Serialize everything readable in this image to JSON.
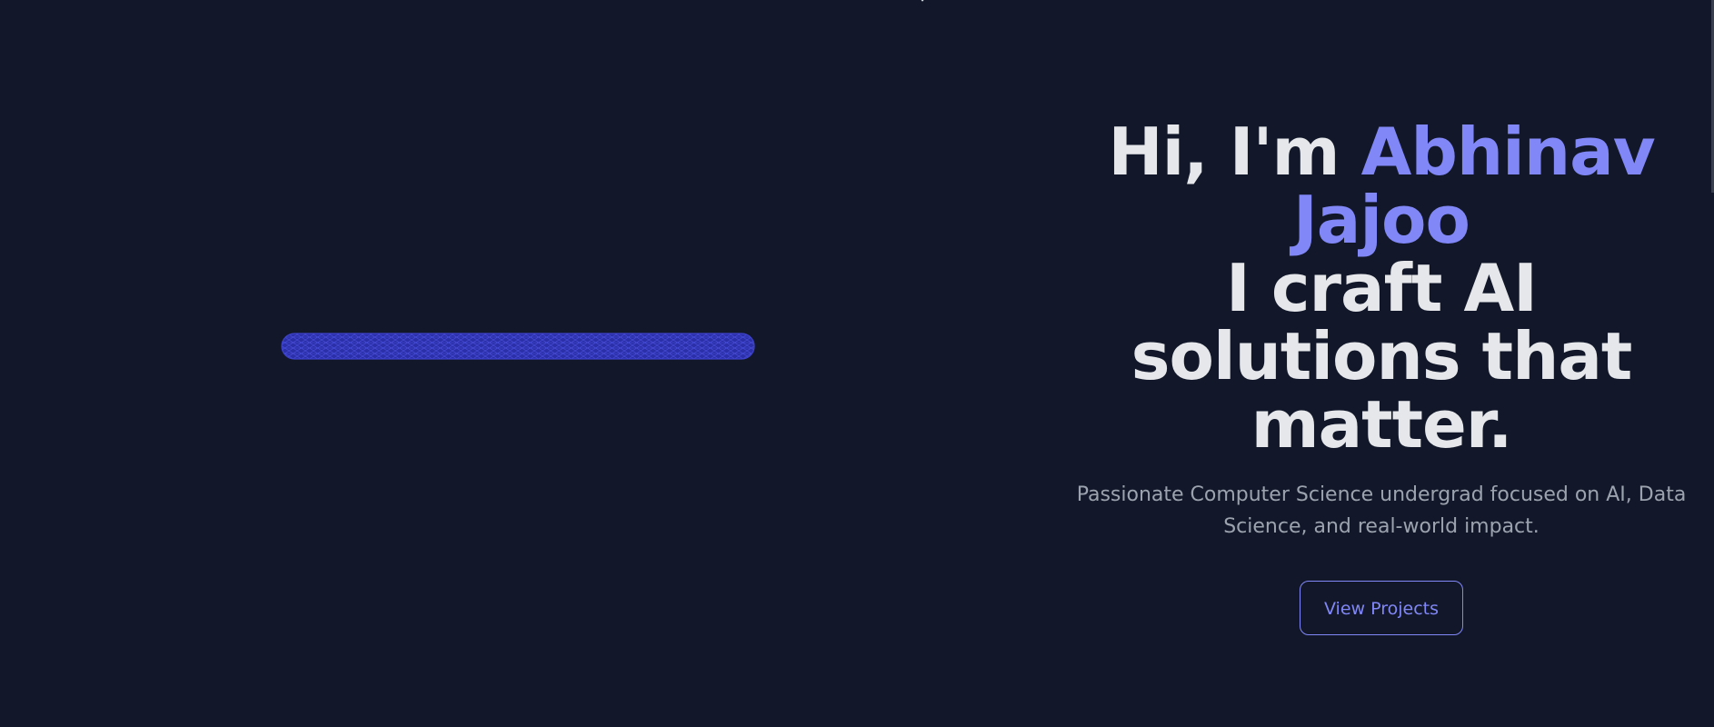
{
  "hero": {
    "greeting": "Hi, I'm",
    "name": "Abhinav Jajoo",
    "tagline": "I craft AI solutions that matter.",
    "description": "Passionate Computer Science undergrad focused on AI, Data Science, and real-world impact.",
    "cta_label": "View Projects"
  },
  "colors": {
    "background": "#121829",
    "heading": "#e5e7eb",
    "accent": "#8187f7",
    "muted": "#9ca3af",
    "torus": "#3338c4"
  },
  "visual": {
    "icon": "wireframe-torus-icon"
  }
}
